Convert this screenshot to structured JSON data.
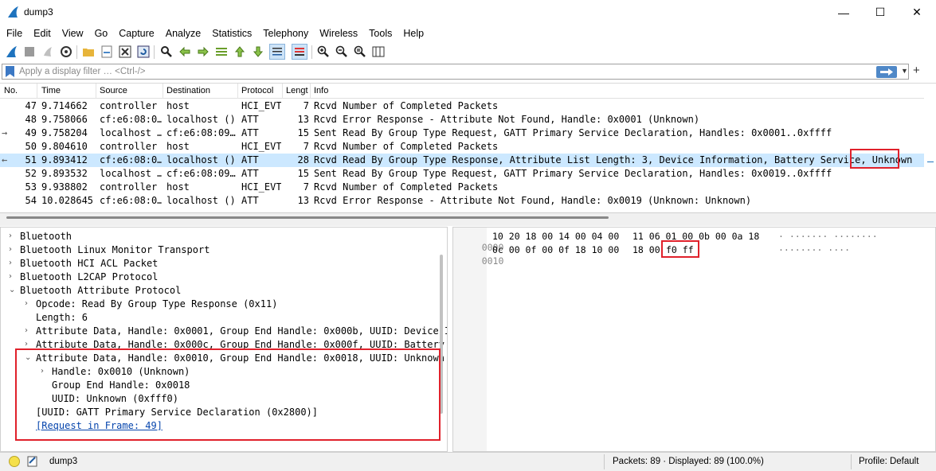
{
  "window": {
    "title": "dump3",
    "minimize_glyph": "—",
    "maximize_glyph": "☐",
    "close_glyph": "✕"
  },
  "menu": [
    "File",
    "Edit",
    "View",
    "Go",
    "Capture",
    "Analyze",
    "Statistics",
    "Telephony",
    "Wireless",
    "Tools",
    "Help"
  ],
  "toolbar_icons": [
    "shark-fin-start-icon",
    "stop-capture-icon",
    "restart-capture-icon",
    "capture-options-icon",
    "open-file-icon",
    "save-file-icon",
    "close-file-icon",
    "reload-file-icon",
    "find-packet-icon",
    "go-back-icon",
    "go-forward-icon",
    "go-to-packet-icon",
    "go-first-icon",
    "go-last-icon",
    "auto-scroll-icon",
    "colorize-icon",
    "zoom-in-icon",
    "zoom-out-icon",
    "zoom-normal-icon",
    "resize-columns-icon"
  ],
  "filter": {
    "placeholder": "Apply a display filter … <Ctrl-/>",
    "add_glyph": "+"
  },
  "packet_list": {
    "columns": [
      "No.",
      "Time",
      "Source",
      "Destination",
      "Protocol",
      "Lengt",
      "Info"
    ],
    "rows": [
      {
        "no": "47",
        "time": "9.714662",
        "src": "controller",
        "dst": "host",
        "proto": "HCI_EVT",
        "len": "7",
        "info": "Rcvd Number of Completed Packets",
        "arrow": "",
        "selected": false
      },
      {
        "no": "48",
        "time": "9.758066",
        "src": "cf:e6:08:0…",
        "dst": "localhost ()",
        "proto": "ATT",
        "len": "13",
        "info": "Rcvd Error Response - Attribute Not Found, Handle: 0x0001 (Unknown)",
        "arrow": "",
        "selected": false
      },
      {
        "no": "49",
        "time": "9.758204",
        "src": "localhost …",
        "dst": "cf:e6:08:09…",
        "proto": "ATT",
        "len": "15",
        "info": "Sent Read By Group Type Request, GATT Primary Service Declaration, Handles: 0x0001..0xffff",
        "arrow": "→",
        "selected": false
      },
      {
        "no": "50",
        "time": "9.804610",
        "src": "controller",
        "dst": "host",
        "proto": "HCI_EVT",
        "len": "7",
        "info": "Rcvd Number of Completed Packets",
        "arrow": "",
        "selected": false
      },
      {
        "no": "51",
        "time": "9.893412",
        "src": "cf:e6:08:0…",
        "dst": "localhost ()",
        "proto": "ATT",
        "len": "28",
        "info": "Rcvd Read By Group Type Response, Attribute List Length: 3, Device Information, Battery Service, Unknown",
        "arrow": "←",
        "selected": true
      },
      {
        "no": "52",
        "time": "9.893532",
        "src": "localhost …",
        "dst": "cf:e6:08:09…",
        "proto": "ATT",
        "len": "15",
        "info": "Sent Read By Group Type Request, GATT Primary Service Declaration, Handles: 0x0019..0xffff",
        "arrow": "",
        "selected": false
      },
      {
        "no": "53",
        "time": "9.938802",
        "src": "controller",
        "dst": "host",
        "proto": "HCI_EVT",
        "len": "7",
        "info": "Rcvd Number of Completed Packets",
        "arrow": "",
        "selected": false
      },
      {
        "no": "54",
        "time": "10.028645",
        "src": "cf:e6:08:0…",
        "dst": "localhost ()",
        "proto": "ATT",
        "len": "13",
        "info": "Rcvd Error Response - Attribute Not Found, Handle: 0x0019 (Unknown: Unknown)",
        "arrow": "",
        "selected": false
      }
    ]
  },
  "details": [
    {
      "text": "Bluetooth",
      "chevron": "›",
      "link": false
    },
    {
      "text": "Bluetooth Linux Monitor Transport",
      "chevron": "›",
      "link": false
    },
    {
      "text": "Bluetooth HCI ACL Packet",
      "chevron": "›",
      "link": false
    },
    {
      "text": "Bluetooth L2CAP Protocol",
      "chevron": "›",
      "link": false
    },
    {
      "text": "Bluetooth Attribute Protocol",
      "chevron": "⌄",
      "link": false
    },
    {
      "text": "Opcode: Read By Group Type Response (0x11)",
      "chevron": "›",
      "link": false
    },
    {
      "text": "Length: 6",
      "chevron": "",
      "link": false
    },
    {
      "text": "Attribute Data, Handle: 0x0001, Group End Handle: 0x000b, UUID: Device I",
      "chevron": "›",
      "link": false
    },
    {
      "text": "Attribute Data, Handle: 0x000c, Group End Handle: 0x000f, UUID: Battery",
      "chevron": "›",
      "link": false
    },
    {
      "text": "Attribute Data, Handle: 0x0010, Group End Handle: 0x0018, UUID: Unknown",
      "chevron": "⌄",
      "link": false
    },
    {
      "text": "Handle: 0x0010 (Unknown)",
      "chevron": "›",
      "link": false
    },
    {
      "text": "Group End Handle: 0x0018",
      "chevron": "",
      "link": false
    },
    {
      "text": "UUID: Unknown (0xfff0)",
      "chevron": "",
      "link": false
    },
    {
      "text": "[UUID: GATT Primary Service Declaration (0x2800)]",
      "chevron": "",
      "link": false
    },
    {
      "text": "[Request in Frame: 49]",
      "chevron": "",
      "link": true
    }
  ],
  "bytes": {
    "lines": [
      {
        "offset": "0000",
        "hex_a": "10 20 18 00 14 00 04 00",
        "hex_b": "11 06 01 00 0b 00 0a 18",
        "hex_b_tail": "",
        "ascii": "· ······· ········"
      },
      {
        "offset": "0010",
        "hex_a": "0c 00 0f 00 0f 18 10 00",
        "hex_b": "18 00",
        "hex_b_tail": "f0 ff",
        "ascii": "········ ····"
      }
    ]
  },
  "status": {
    "file": "dump3",
    "packets": "Packets: 89 · Displayed: 89 (100.0%)",
    "profile": "Profile: Default"
  },
  "colors": {
    "highlight": "#e0212b",
    "selected_row": "#cce8ff",
    "link": "#0645ad"
  }
}
